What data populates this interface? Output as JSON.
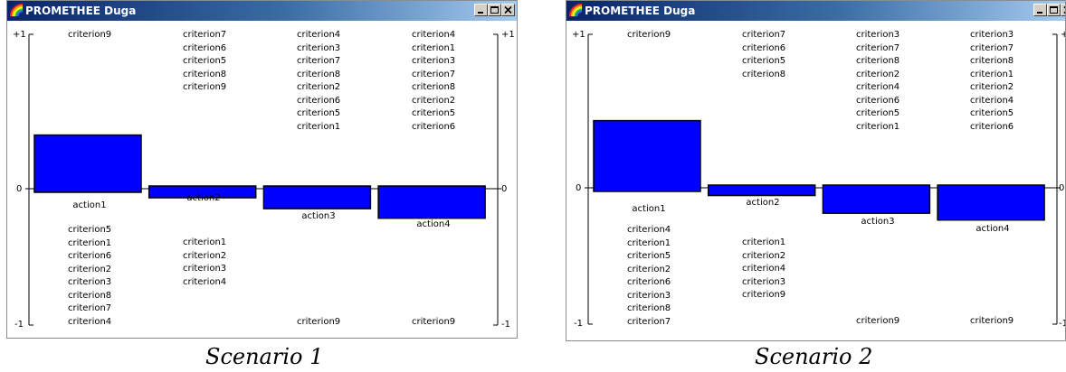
{
  "colors": {
    "bar_fill": "#0000ff",
    "axis": "#000000",
    "titlebar_start": "#0a246a",
    "titlebar_end": "#a6caf0"
  },
  "icons": {
    "app": "rainbow-icon",
    "minimize": "minimize-icon",
    "maximize": "maximize-icon",
    "close": "close-icon"
  },
  "windows": [
    {
      "title": "PROMETHEE Duga",
      "caption": "Scenario 1",
      "axis_labels": {
        "top": "+1",
        "zero": "0",
        "bottom": "-1"
      },
      "actions": [
        {
          "label": "action1",
          "phi": 0.33,
          "top_criteria": [
            "criterion9"
          ],
          "bottom_criteria": [
            "criterion5",
            "criterion1",
            "criterion6",
            "criterion2",
            "criterion3",
            "criterion8",
            "criterion7",
            "criterion4"
          ]
        },
        {
          "label": "action2",
          "phi": -0.04,
          "top_criteria": [
            "criterion7",
            "criterion6",
            "criterion5",
            "criterion8",
            "criterion9"
          ],
          "bottom_criteria": [
            "criterion1",
            "criterion2",
            "criterion3",
            "criterion4"
          ]
        },
        {
          "label": "action3",
          "phi": -0.12,
          "top_criteria": [
            "criterion4",
            "criterion3",
            "criterion7",
            "criterion8",
            "criterion2",
            "criterion6",
            "criterion5",
            "criterion1"
          ],
          "bottom_criteria": [
            "criterion9"
          ]
        },
        {
          "label": "action4",
          "phi": -0.19,
          "top_criteria": [
            "criterion4",
            "criterion1",
            "criterion3",
            "criterion7",
            "criterion8",
            "criterion2",
            "criterion5",
            "criterion6"
          ],
          "bottom_criteria": [
            "criterion9"
          ]
        }
      ]
    },
    {
      "title": "PROMETHEE Duga",
      "caption": "Scenario 2",
      "axis_labels": {
        "top": "+1",
        "zero": "0",
        "bottom": "-1"
      },
      "actions": [
        {
          "label": "action1",
          "phi": 0.42,
          "top_criteria": [
            "criterion9"
          ],
          "bottom_criteria": [
            "criterion4",
            "criterion1",
            "criterion5",
            "criterion2",
            "criterion6",
            "criterion3",
            "criterion8",
            "criterion7"
          ]
        },
        {
          "label": "action2",
          "phi": -0.03,
          "top_criteria": [
            "criterion7",
            "criterion6",
            "criterion5",
            "criterion8"
          ],
          "bottom_criteria": [
            "criterion1",
            "criterion2",
            "criterion4",
            "criterion3",
            "criterion9"
          ]
        },
        {
          "label": "action3",
          "phi": -0.16,
          "top_criteria": [
            "criterion3",
            "criterion7",
            "criterion8",
            "criterion2",
            "criterion4",
            "criterion6",
            "criterion5",
            "criterion1"
          ],
          "bottom_criteria": [
            "criterion9"
          ]
        },
        {
          "label": "action4",
          "phi": -0.21,
          "top_criteria": [
            "criterion3",
            "criterion7",
            "criterion8",
            "criterion1",
            "criterion2",
            "criterion4",
            "criterion5",
            "criterion6"
          ],
          "bottom_criteria": [
            "criterion9"
          ]
        }
      ]
    }
  ]
}
